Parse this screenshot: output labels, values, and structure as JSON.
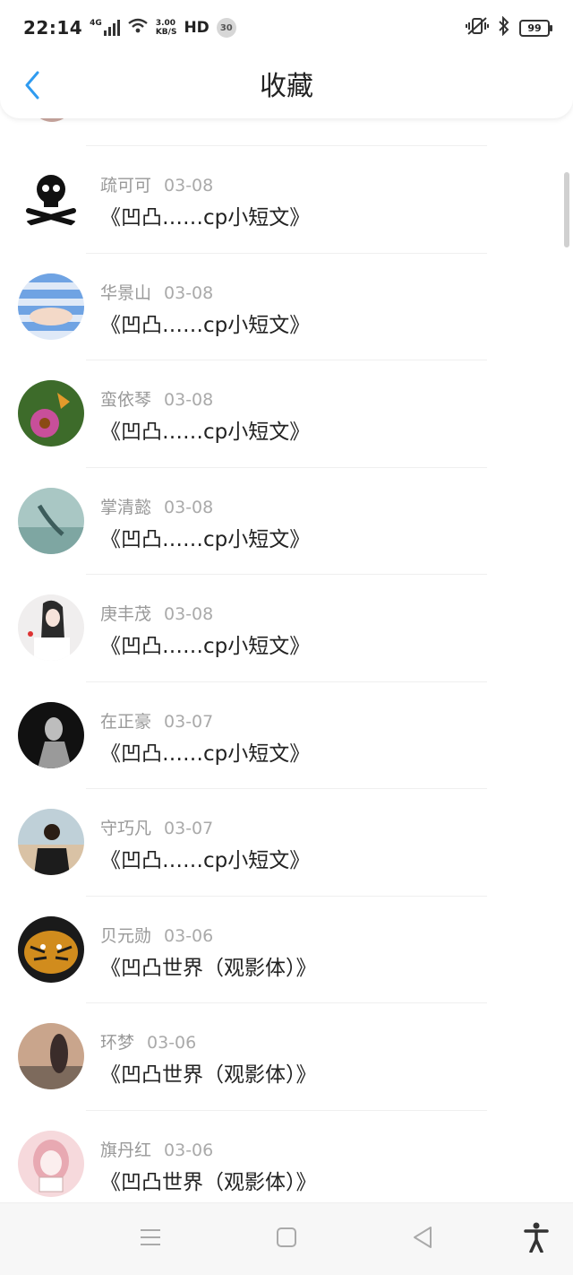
{
  "status_bar": {
    "time": "22:14",
    "network": "4G",
    "speed_top": "3.00",
    "speed_bottom": "KB/S",
    "hd": "HD",
    "badge": "30",
    "battery": "99"
  },
  "header": {
    "title": "收藏",
    "back_icon": "chevron-left-icon"
  },
  "items": [
    {
      "name": "疏可可",
      "date": "03-08",
      "title": "《凹凸……cp小短文》",
      "avatar_colors": [
        "#ffffff",
        "#111111"
      ]
    },
    {
      "name": "华景山",
      "date": "03-08",
      "title": "《凹凸……cp小短文》",
      "avatar_colors": [
        "#6fa3e3",
        "#dfe9f7"
      ]
    },
    {
      "name": "蛮依琴",
      "date": "03-08",
      "title": "《凹凸……cp小短文》",
      "avatar_colors": [
        "#3d6b2a",
        "#c84f9a"
      ]
    },
    {
      "name": "掌清懿",
      "date": "03-08",
      "title": "《凹凸……cp小短文》",
      "avatar_colors": [
        "#a9c7c4",
        "#3d5d5c"
      ]
    },
    {
      "name": "庚丰茂",
      "date": "03-08",
      "title": "《凹凸……cp小短文》",
      "avatar_colors": [
        "#f0eeee",
        "#2a2a2a"
      ]
    },
    {
      "name": "在正豪",
      "date": "03-07",
      "title": "《凹凸……cp小短文》",
      "avatar_colors": [
        "#111111",
        "#9a9a9a"
      ]
    },
    {
      "name": "守巧凡",
      "date": "03-07",
      "title": "《凹凸……cp小短文》",
      "avatar_colors": [
        "#d9c2a5",
        "#1c1c1c"
      ]
    },
    {
      "name": "贝元勋",
      "date": "03-06",
      "title": "《凹凸世界（观影体）》",
      "avatar_colors": [
        "#d18c1d",
        "#1a1a1a"
      ]
    },
    {
      "name": "环梦",
      "date": "03-06",
      "title": "《凹凸世界（观影体）》",
      "avatar_colors": [
        "#c9a58c",
        "#3a2c2a"
      ]
    },
    {
      "name": "旗丹红",
      "date": "03-06",
      "title": "《凹凸世界（观影体）》",
      "avatar_colors": [
        "#f6d9dc",
        "#e8a9b2"
      ]
    }
  ],
  "nav": {
    "menu_icon": "menu-icon",
    "home_icon": "square-icon",
    "back_icon": "triangle-back-icon",
    "accessibility_icon": "accessibility-icon"
  },
  "colors": {
    "accent": "#1e90ff",
    "meta_text": "#999999",
    "divider": "#efefef"
  }
}
